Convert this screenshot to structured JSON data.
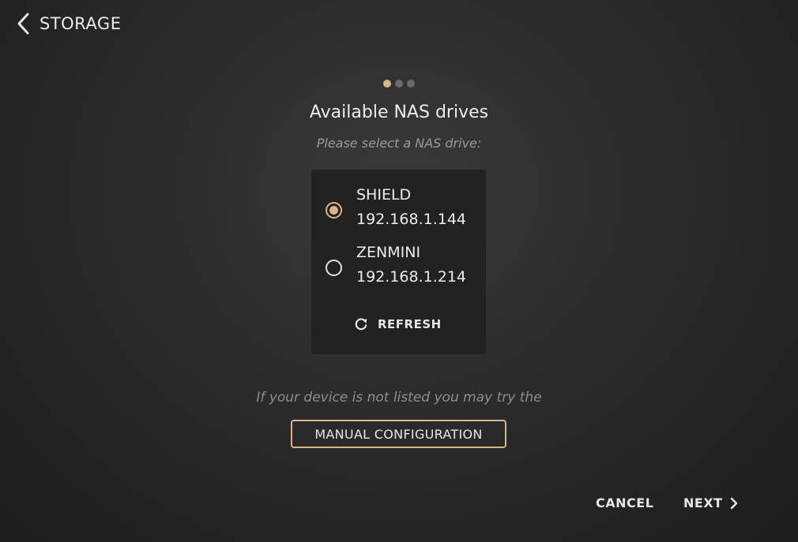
{
  "header": {
    "back_label": "STORAGE",
    "back_icon": "chevron-left-icon"
  },
  "stepper": {
    "total_steps": 3,
    "current_step": 1
  },
  "main": {
    "title": "Available NAS drives",
    "subtitle": "Please select a NAS drive:",
    "drives": [
      {
        "name": "SHIELD",
        "ip": "192.168.1.144",
        "selected": true
      },
      {
        "name": "ZENMINI",
        "ip": "192.168.1.214",
        "selected": false
      }
    ],
    "refresh_label": "REFRESH",
    "refresh_icon": "refresh-icon",
    "hint": "If your device is not listed you may try the",
    "manual_label": "MANUAL CONFIGURATION"
  },
  "footer": {
    "cancel_label": "CANCEL",
    "next_label": "NEXT",
    "next_icon": "chevron-right-icon"
  },
  "colors": {
    "accent": "#d9b48a",
    "background": "#2a2a2a",
    "panel": "#222222",
    "text": "#ececec",
    "muted": "#9a9a9a"
  }
}
